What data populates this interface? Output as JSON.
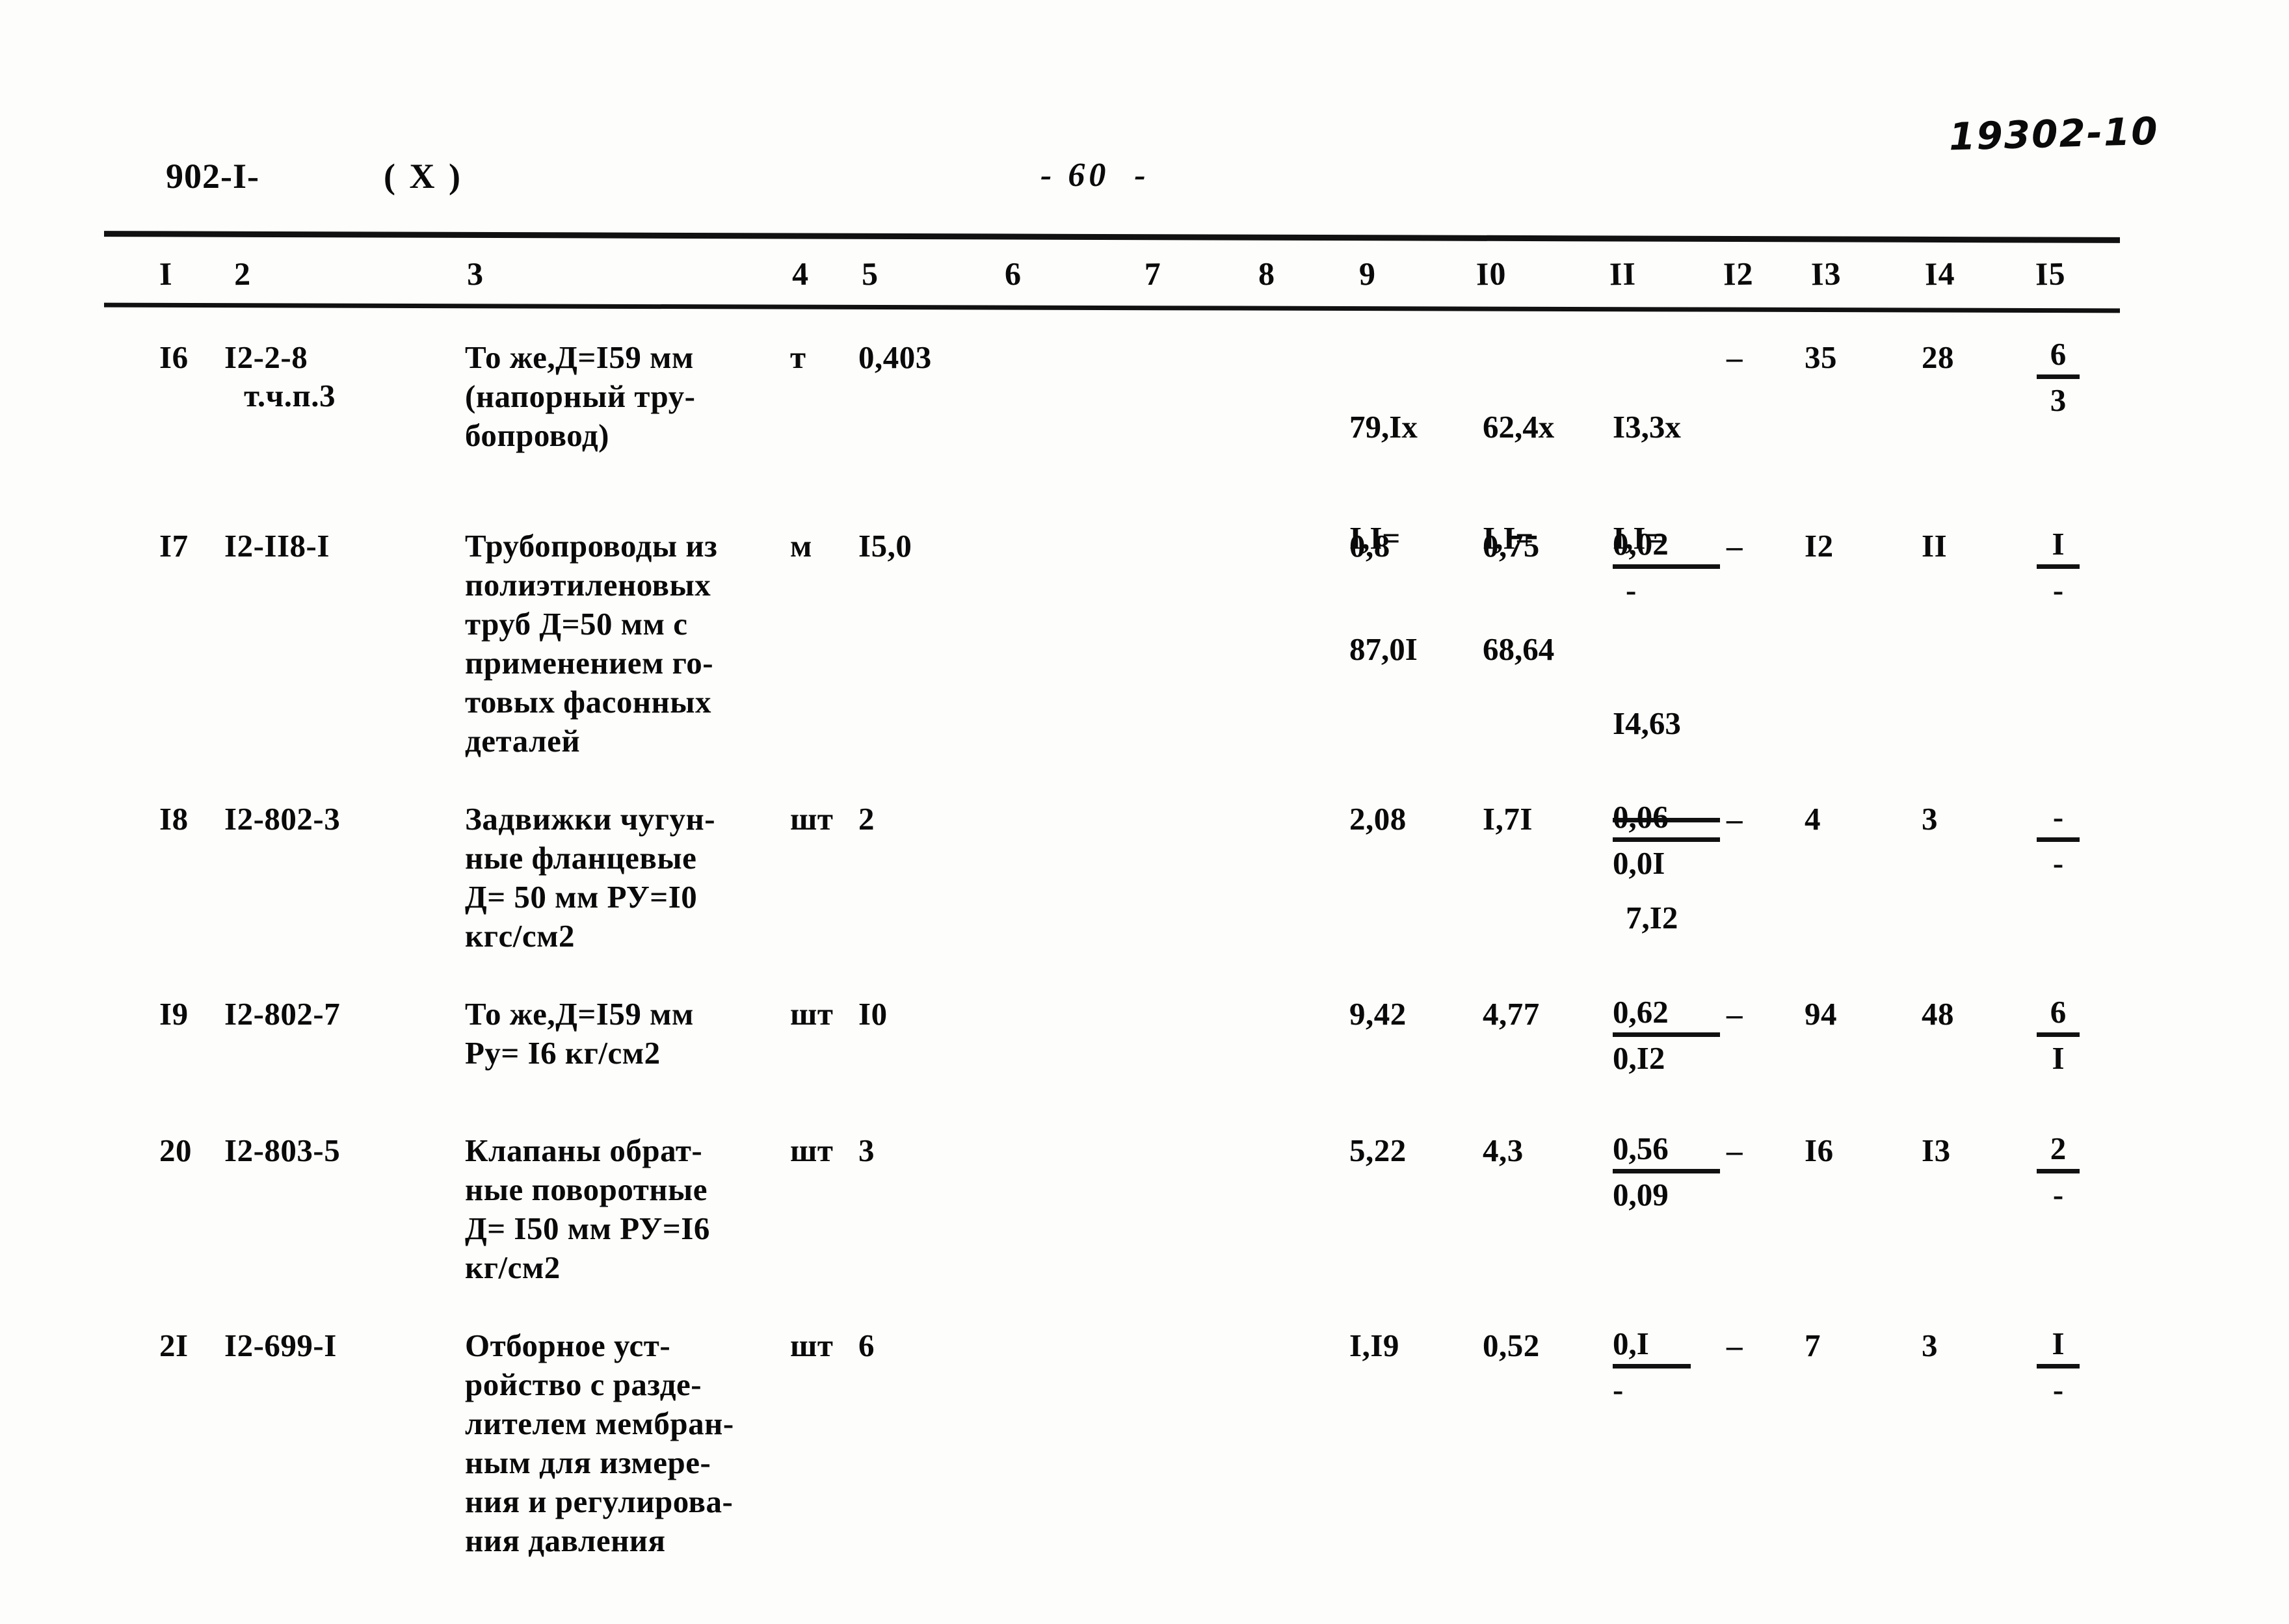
{
  "header": {
    "doc_code": "902-I-",
    "doc_variant": "( X )",
    "page_number": "- 60  -",
    "archive_stamp": "19302-10"
  },
  "table": {
    "column_headers": [
      "I",
      "2",
      "3",
      "4",
      "5",
      "6",
      "7",
      "8",
      "9",
      "I0",
      "II",
      "I2",
      "I3",
      "I4",
      "I5"
    ],
    "rows": [
      {
        "num": "I6",
        "code": "I2-2-8",
        "code_note": "т.ч.п.3",
        "description": "То же,Д=I59 мм\n(напорный тру-\nбопровод)",
        "unit": "т",
        "qty": "0,403",
        "c9_line1": "79,Ix",
        "c9_line2": "I,I=",
        "c9_line3": "87,0I",
        "c10_line1": "62,4x",
        "c10_line2": "I,I=",
        "c10_line3": "68,64",
        "c11_line1": "I3,3x",
        "c11_line2": "I,I=",
        "c11_num": "I4,63",
        "c11_den": "7,I2",
        "c12": "–",
        "c13": "35",
        "c14": "28",
        "c15_num": "6",
        "c15_den": "3"
      },
      {
        "num": "I7",
        "code": "I2-II8-I",
        "code_note": "",
        "description": "Трубопроводы из\nполиэтиленовых\nтруб Д=50 мм с\nприменением го-\nтовых фасонных\nдеталей",
        "unit": "м",
        "qty": "I5,0",
        "c9": "0,8",
        "c10": "0,75",
        "c11_num": "0,02",
        "c11_den": "-",
        "c12": "–",
        "c13": "I2",
        "c14": "II",
        "c15_num": "I",
        "c15_den": "-"
      },
      {
        "num": "I8",
        "code": "I2-802-3",
        "code_note": "",
        "description": "Задвижки чугун-\nные фланцевые\nД= 50 мм РУ=I0\nкгс/см2",
        "unit": "шт",
        "qty": "2",
        "c9": "2,08",
        "c10": "I,7I",
        "c11_num": "0,06",
        "c11_den": "0,0I",
        "c12": "–",
        "c13": "4",
        "c14": "3",
        "c15_num": "-",
        "c15_den": "-"
      },
      {
        "num": "I9",
        "code": "I2-802-7",
        "code_note": "",
        "description": "То же,Д=I59 мм\nРу= I6 кг/см2",
        "unit": "шт",
        "qty": "I0",
        "c9": "9,42",
        "c10": "4,77",
        "c11_num": "0,62",
        "c11_den": "0,I2",
        "c12": "–",
        "c13": "94",
        "c14": "48",
        "c15_num": "6",
        "c15_den": "I"
      },
      {
        "num": "20",
        "code": "I2-803-5",
        "code_note": "",
        "description": "Клапаны обрат-\nные поворотные\nД= I50 мм РУ=I6\nкг/см2",
        "unit": "шт",
        "qty": "3",
        "c9": "5,22",
        "c10": "4,3",
        "c11_num": "0,56",
        "c11_den": "0,09",
        "c12": "–",
        "c13": "I6",
        "c14": "I3",
        "c15_num": "2",
        "c15_den": "-"
      },
      {
        "num": "2I",
        "code": "I2-699-I",
        "code_note": "",
        "description": "Отборное уст-\nройство с разде-\nлителем мембран-\nным для измере-\nния и регулирова-\nния давления",
        "unit": "шт",
        "qty": "6",
        "c9": "I,I9",
        "c10": "0,52",
        "c11_num": "0,I",
        "c11_den": "-",
        "c12": "–",
        "c13": "7",
        "c14": "3",
        "c15_num": "I",
        "c15_den": "-"
      }
    ]
  }
}
